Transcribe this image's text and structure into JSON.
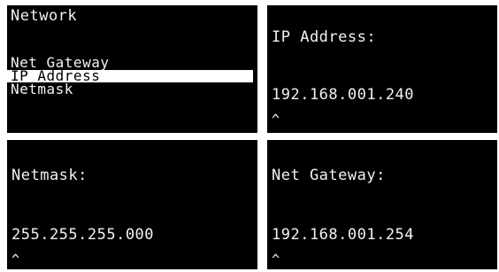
{
  "network_menu": {
    "title": "Network",
    "items": [
      {
        "label": "Net Gateway",
        "selected": false
      },
      {
        "label": "IP Address",
        "selected": true
      },
      {
        "label": "Netmask",
        "selected": false
      }
    ]
  },
  "ip_address_screen": {
    "label": "IP Address:",
    "value": "192.168.001.240",
    "cursor": "^"
  },
  "netmask_screen": {
    "label": "Netmask:",
    "value": "255.255.255.000",
    "cursor": "^"
  },
  "gateway_screen": {
    "label": "Net Gateway:",
    "value": "192.168.001.254",
    "cursor": "^"
  },
  "colors": {
    "screen_background": "#000000",
    "text": "#f2f2f2",
    "selection_background": "#ffffff",
    "selection_text": "#000000"
  }
}
